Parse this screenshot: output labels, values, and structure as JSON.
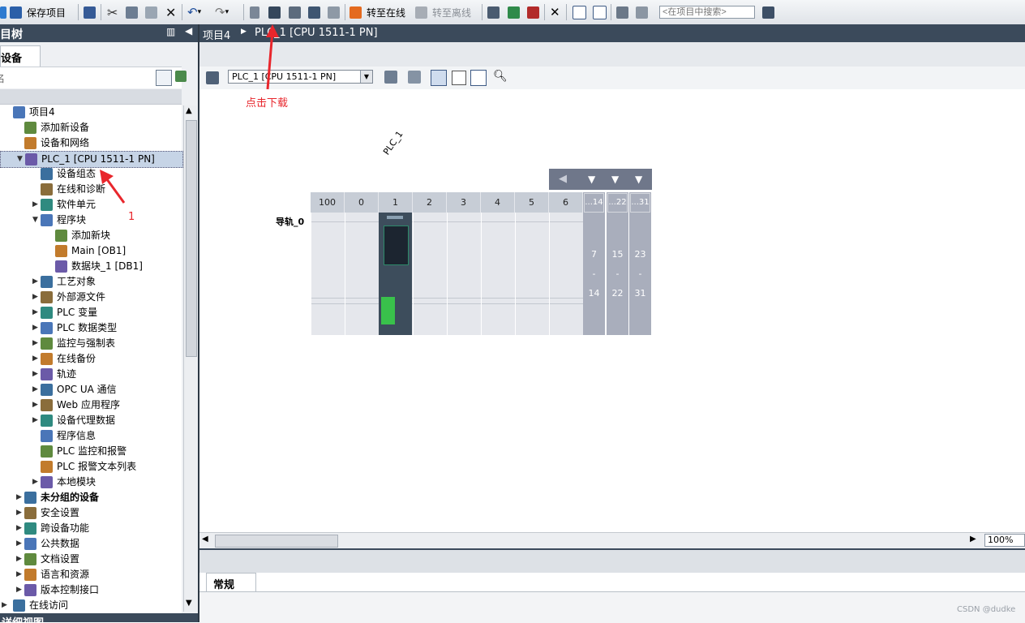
{
  "toolbar": {
    "save_project": "保存项目",
    "go_online": "转至在线",
    "go_offline": "转至离线",
    "search_placeholder": "<在项目中搜索>"
  },
  "left_panel": {
    "title": "目树",
    "tab": "设备",
    "filter_label": "名"
  },
  "tree": [
    {
      "label": "项目4",
      "indent": 0
    },
    {
      "label": "添加新设备",
      "indent": 1
    },
    {
      "label": "设备和网络",
      "indent": 1
    },
    {
      "label": "PLC_1 [CPU 1511-1 PN]",
      "indent": 1,
      "selected": true,
      "expanded": true
    },
    {
      "label": "设备组态",
      "indent": 2
    },
    {
      "label": "在线和诊断",
      "indent": 2
    },
    {
      "label": "软件单元",
      "indent": 2,
      "arrow": "right"
    },
    {
      "label": "程序块",
      "indent": 2,
      "arrow": "down"
    },
    {
      "label": "添加新块",
      "indent": 3
    },
    {
      "label": "Main [OB1]",
      "indent": 3
    },
    {
      "label": "数据块_1 [DB1]",
      "indent": 3
    },
    {
      "label": "工艺对象",
      "indent": 2,
      "arrow": "right"
    },
    {
      "label": "外部源文件",
      "indent": 2,
      "arrow": "right"
    },
    {
      "label": "PLC 变量",
      "indent": 2,
      "arrow": "right"
    },
    {
      "label": "PLC 数据类型",
      "indent": 2,
      "arrow": "right"
    },
    {
      "label": "监控与强制表",
      "indent": 2,
      "arrow": "right"
    },
    {
      "label": "在线备份",
      "indent": 2,
      "arrow": "right"
    },
    {
      "label": "轨迹",
      "indent": 2,
      "arrow": "right"
    },
    {
      "label": "OPC UA 通信",
      "indent": 2,
      "arrow": "right"
    },
    {
      "label": "Web 应用程序",
      "indent": 2,
      "arrow": "right"
    },
    {
      "label": "设备代理数据",
      "indent": 2,
      "arrow": "right"
    },
    {
      "label": "程序信息",
      "indent": 2
    },
    {
      "label": "PLC 监控和报警",
      "indent": 2
    },
    {
      "label": "PLC 报警文本列表",
      "indent": 2
    },
    {
      "label": "本地模块",
      "indent": 2,
      "arrow": "right"
    },
    {
      "label": "未分组的设备",
      "indent": 1,
      "arrow": "right",
      "bold": true
    },
    {
      "label": "安全设置",
      "indent": 1,
      "arrow": "right"
    },
    {
      "label": "跨设备功能",
      "indent": 1,
      "arrow": "right"
    },
    {
      "label": "公共数据",
      "indent": 1,
      "arrow": "right"
    },
    {
      "label": "文档设置",
      "indent": 1,
      "arrow": "right"
    },
    {
      "label": "语言和资源",
      "indent": 1,
      "arrow": "right"
    },
    {
      "label": "版本控制接口",
      "indent": 1,
      "arrow": "right"
    },
    {
      "label": "在线访问",
      "indent": 0,
      "arrow": "right"
    }
  ],
  "bottom_left_title": "详细视图",
  "editor": {
    "breadcrumb_project": "项目4",
    "breadcrumb_device": "PLC_1 [CPU 1511-1 PN]",
    "device_select": "PLC_1 [CPU 1511-1 PN]",
    "plc_label": "PLC_1",
    "rail_label": "导轨_0",
    "slots": [
      "100",
      "0",
      "1",
      "2",
      "3",
      "4",
      "5",
      "6"
    ],
    "ext_heads": [
      "...14",
      "...22",
      "...31"
    ],
    "ext_ranges": [
      [
        "7",
        "-",
        "14"
      ],
      [
        "15",
        "-",
        "22"
      ],
      [
        "23",
        "-",
        "31"
      ]
    ],
    "zoom": "100%"
  },
  "inspector": {
    "tab": "常规"
  },
  "annotations": {
    "download_hint": "点击下载",
    "step_number": "1",
    "color": "#e8262c"
  },
  "watermark": "CSDN @dudke"
}
